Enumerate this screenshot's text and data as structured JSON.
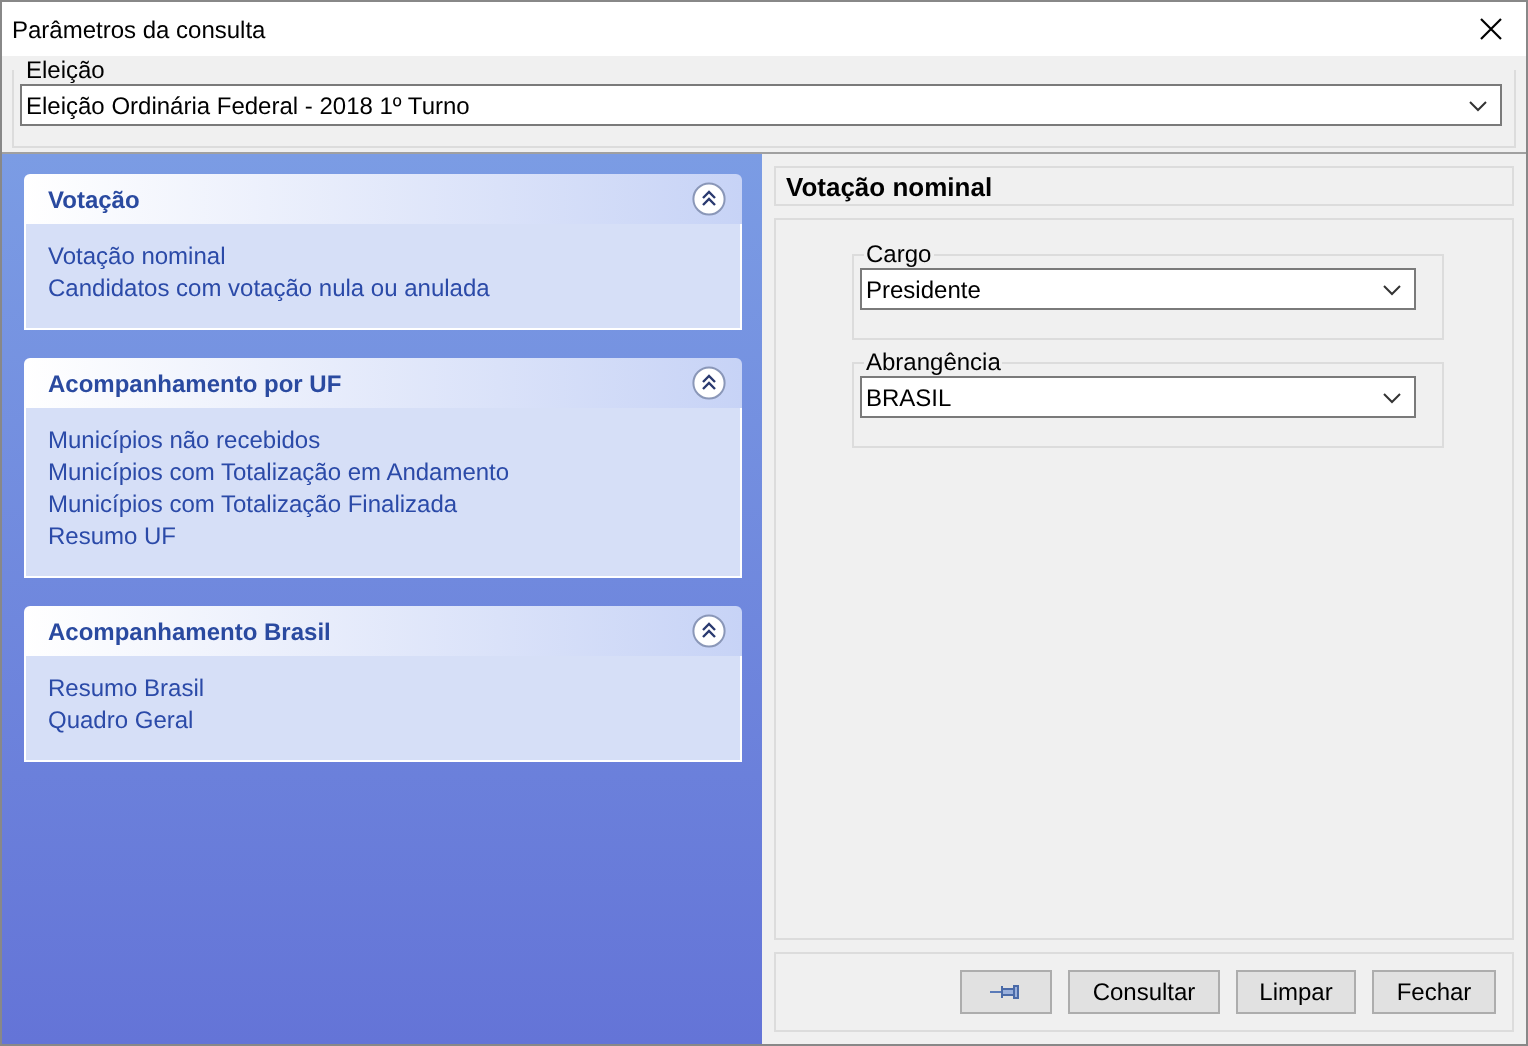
{
  "window": {
    "title": "Parâmetros da consulta"
  },
  "election": {
    "label": "Eleição",
    "value": "Eleição Ordinária Federal - 2018 1º Turno"
  },
  "sections": [
    {
      "title": "Votação",
      "expanded": true,
      "items": [
        "Votação nominal",
        "Candidatos com votação nula ou anulada"
      ]
    },
    {
      "title": "Acompanhamento por UF",
      "expanded": true,
      "items": [
        "Municípios não recebidos",
        "Municípios com Totalização em Andamento",
        "Municípios com Totalização Finalizada",
        "Resumo UF"
      ]
    },
    {
      "title": "Acompanhamento Brasil",
      "expanded": true,
      "items": [
        "Resumo Brasil",
        "Quadro Geral"
      ]
    }
  ],
  "panel": {
    "title": "Votação nominal",
    "fields": [
      {
        "label": "Cargo",
        "value": "Presidente"
      },
      {
        "label": "Abrangência",
        "value": "BRASIL"
      }
    ]
  },
  "buttons": [
    {
      "kind": "pin"
    },
    {
      "kind": "text",
      "label": "Consultar"
    },
    {
      "kind": "text",
      "label": "Limpar"
    },
    {
      "kind": "text",
      "label": "Fechar"
    }
  ]
}
